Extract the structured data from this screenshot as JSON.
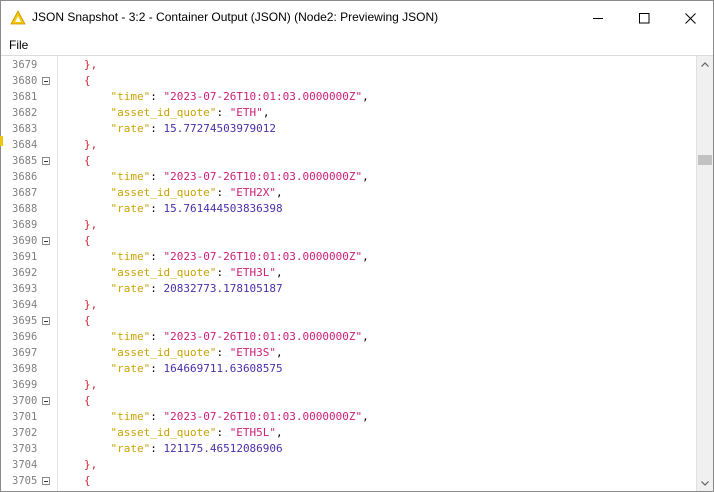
{
  "window": {
    "title": "JSON Snapshot - 3:2 - Container Output (JSON) (Node2: Previewing JSON)",
    "controls": [
      "minimize",
      "maximize",
      "close"
    ]
  },
  "menu": {
    "items": [
      "File"
    ]
  },
  "colors": {
    "brace": "#cc2a36",
    "key": "#c8a300",
    "string": "#cc1f7a",
    "number": "#4b2fa8",
    "line_number": "#808080"
  },
  "editor": {
    "lines": [
      {
        "n": "3679",
        "fold": false,
        "indent": 8,
        "brace": "},",
        "key": "",
        "str": "",
        "num": "",
        "comma": ""
      },
      {
        "n": "3680",
        "fold": true,
        "indent": 8,
        "brace": "{",
        "key": "",
        "str": "",
        "num": "",
        "comma": ""
      },
      {
        "n": "3681",
        "fold": false,
        "indent": 12,
        "brace": "",
        "key": "\"time\"",
        "str": "\"2023-07-26T10:01:03.0000000Z\"",
        "num": "",
        "comma": ","
      },
      {
        "n": "3682",
        "fold": false,
        "indent": 12,
        "brace": "",
        "key": "\"asset_id_quote\"",
        "str": "\"ETH\"",
        "num": "",
        "comma": ","
      },
      {
        "n": "3683",
        "fold": false,
        "indent": 12,
        "brace": "",
        "key": "\"rate\"",
        "str": "",
        "num": "15.77274503979012",
        "comma": ""
      },
      {
        "n": "3684",
        "fold": false,
        "indent": 8,
        "brace": "},",
        "key": "",
        "str": "",
        "num": "",
        "comma": ""
      },
      {
        "n": "3685",
        "fold": true,
        "indent": 8,
        "brace": "{",
        "key": "",
        "str": "",
        "num": "",
        "comma": ""
      },
      {
        "n": "3686",
        "fold": false,
        "indent": 12,
        "brace": "",
        "key": "\"time\"",
        "str": "\"2023-07-26T10:01:03.0000000Z\"",
        "num": "",
        "comma": ","
      },
      {
        "n": "3687",
        "fold": false,
        "indent": 12,
        "brace": "",
        "key": "\"asset_id_quote\"",
        "str": "\"ETH2X\"",
        "num": "",
        "comma": ","
      },
      {
        "n": "3688",
        "fold": false,
        "indent": 12,
        "brace": "",
        "key": "\"rate\"",
        "str": "",
        "num": "15.761444503836398",
        "comma": ""
      },
      {
        "n": "3689",
        "fold": false,
        "indent": 8,
        "brace": "},",
        "key": "",
        "str": "",
        "num": "",
        "comma": ""
      },
      {
        "n": "3690",
        "fold": true,
        "indent": 8,
        "brace": "{",
        "key": "",
        "str": "",
        "num": "",
        "comma": ""
      },
      {
        "n": "3691",
        "fold": false,
        "indent": 12,
        "brace": "",
        "key": "\"time\"",
        "str": "\"2023-07-26T10:01:03.0000000Z\"",
        "num": "",
        "comma": ","
      },
      {
        "n": "3692",
        "fold": false,
        "indent": 12,
        "brace": "",
        "key": "\"asset_id_quote\"",
        "str": "\"ETH3L\"",
        "num": "",
        "comma": ","
      },
      {
        "n": "3693",
        "fold": false,
        "indent": 12,
        "brace": "",
        "key": "\"rate\"",
        "str": "",
        "num": "20832773.178105187",
        "comma": ""
      },
      {
        "n": "3694",
        "fold": false,
        "indent": 8,
        "brace": "},",
        "key": "",
        "str": "",
        "num": "",
        "comma": ""
      },
      {
        "n": "3695",
        "fold": true,
        "indent": 8,
        "brace": "{",
        "key": "",
        "str": "",
        "num": "",
        "comma": ""
      },
      {
        "n": "3696",
        "fold": false,
        "indent": 12,
        "brace": "",
        "key": "\"time\"",
        "str": "\"2023-07-26T10:01:03.0000000Z\"",
        "num": "",
        "comma": ","
      },
      {
        "n": "3697",
        "fold": false,
        "indent": 12,
        "brace": "",
        "key": "\"asset_id_quote\"",
        "str": "\"ETH3S\"",
        "num": "",
        "comma": ","
      },
      {
        "n": "3698",
        "fold": false,
        "indent": 12,
        "brace": "",
        "key": "\"rate\"",
        "str": "",
        "num": "164669711.63608575",
        "comma": ""
      },
      {
        "n": "3699",
        "fold": false,
        "indent": 8,
        "brace": "},",
        "key": "",
        "str": "",
        "num": "",
        "comma": ""
      },
      {
        "n": "3700",
        "fold": true,
        "indent": 8,
        "brace": "{",
        "key": "",
        "str": "",
        "num": "",
        "comma": ""
      },
      {
        "n": "3701",
        "fold": false,
        "indent": 12,
        "brace": "",
        "key": "\"time\"",
        "str": "\"2023-07-26T10:01:03.0000000Z\"",
        "num": "",
        "comma": ","
      },
      {
        "n": "3702",
        "fold": false,
        "indent": 12,
        "brace": "",
        "key": "\"asset_id_quote\"",
        "str": "\"ETH5L\"",
        "num": "",
        "comma": ","
      },
      {
        "n": "3703",
        "fold": false,
        "indent": 12,
        "brace": "",
        "key": "\"rate\"",
        "str": "",
        "num": "121175.46512086906",
        "comma": ""
      },
      {
        "n": "3704",
        "fold": false,
        "indent": 8,
        "brace": "},",
        "key": "",
        "str": "",
        "num": "",
        "comma": ""
      },
      {
        "n": "3705",
        "fold": true,
        "indent": 8,
        "brace": "{",
        "key": "",
        "str": "",
        "num": "",
        "comma": ""
      }
    ]
  },
  "scrollbar": {
    "vertical_position_fraction": 0.21
  }
}
